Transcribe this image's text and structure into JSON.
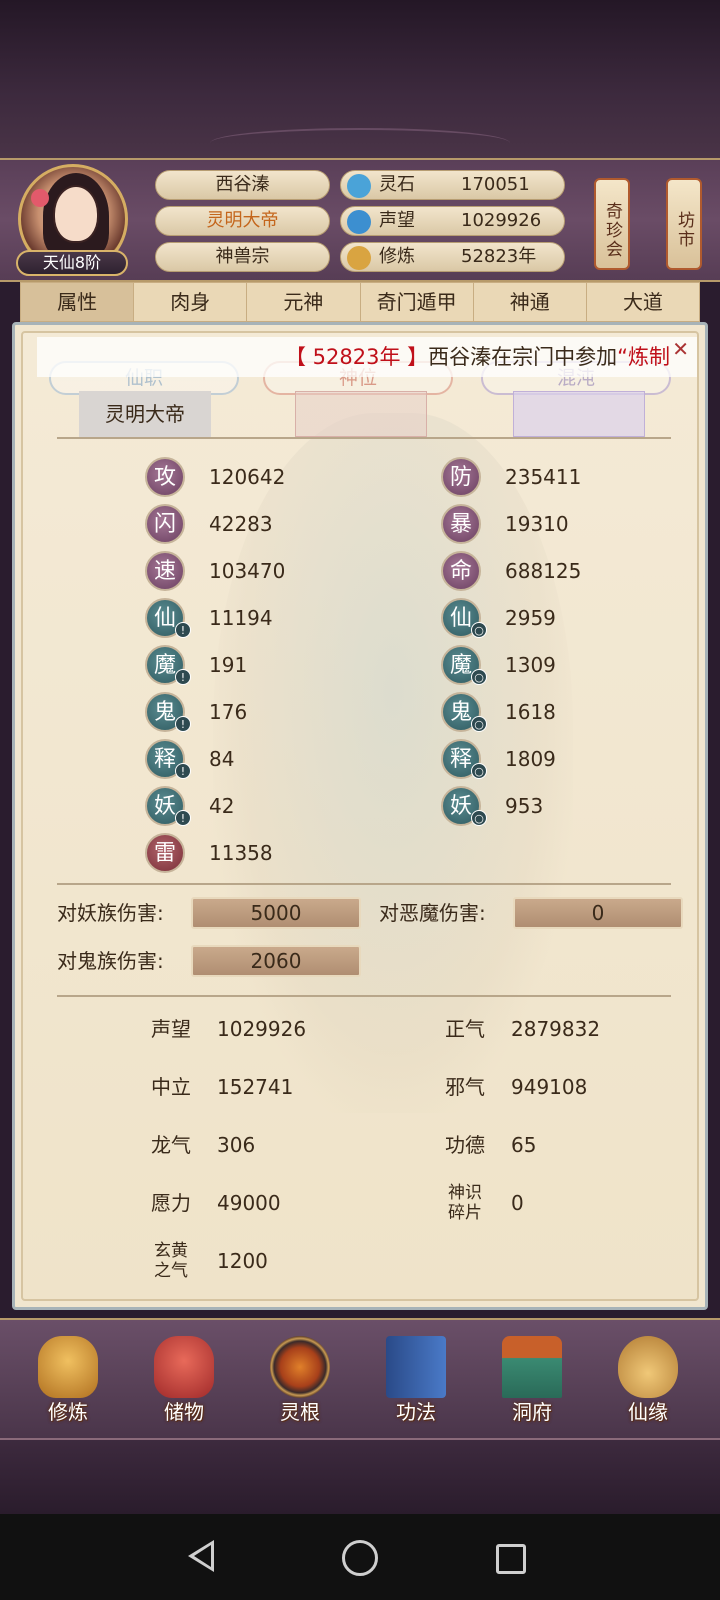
{
  "header": {
    "rank_badge": "天仙8阶",
    "player_name": "西谷溱",
    "player_title": "灵明大帝",
    "sect": "神兽宗",
    "resources": [
      {
        "icon": "spirit-stone-icon",
        "label": "灵石",
        "value": "170051",
        "color": "#4aa3d8"
      },
      {
        "icon": "reputation-icon",
        "label": "声望",
        "value": "1029926",
        "color": "#3c8fd0"
      },
      {
        "icon": "cultivation-icon",
        "label": "修炼",
        "value": "52823年",
        "color": "#d9a441"
      }
    ],
    "side_buttons": [
      "奇珍会",
      "坊市"
    ]
  },
  "tabs": [
    "属性",
    "肉身",
    "元神",
    "奇门遁甲",
    "神通",
    "大道"
  ],
  "active_tab": "属性",
  "marquee": {
    "prefix": "【 52823年 】",
    "name": "西谷溱",
    "text": "在宗门中参加",
    "suffix": "“炼制"
  },
  "rank_tabs": [
    {
      "label": "仙职",
      "value": "灵明大帝"
    },
    {
      "label": "神位",
      "value": ""
    },
    {
      "label": "混沌",
      "value": ""
    }
  ],
  "stats_left": [
    {
      "glyph": "攻",
      "value": "120642",
      "style": "purple",
      "badge": false
    },
    {
      "glyph": "闪",
      "value": "42283",
      "style": "purple",
      "badge": false
    },
    {
      "glyph": "速",
      "value": "103470",
      "style": "purple",
      "badge": false
    },
    {
      "glyph": "仙",
      "value": "11194",
      "style": "teal",
      "badge": true
    },
    {
      "glyph": "魔",
      "value": "191",
      "style": "teal",
      "badge": true
    },
    {
      "glyph": "鬼",
      "value": "176",
      "style": "teal",
      "badge": true
    },
    {
      "glyph": "释",
      "value": "84",
      "style": "teal",
      "badge": true
    },
    {
      "glyph": "妖",
      "value": "42",
      "style": "teal",
      "badge": true
    },
    {
      "glyph": "雷",
      "value": "11358",
      "style": "red",
      "badge": false
    }
  ],
  "stats_right": [
    {
      "glyph": "防",
      "value": "235411",
      "style": "purple",
      "badge": false
    },
    {
      "glyph": "暴",
      "value": "19310",
      "style": "purple",
      "badge": false
    },
    {
      "glyph": "命",
      "value": "688125",
      "style": "purple",
      "badge": false
    },
    {
      "glyph": "仙",
      "value": "2959",
      "style": "teal",
      "badge": true
    },
    {
      "glyph": "魔",
      "value": "1309",
      "style": "teal",
      "badge": true
    },
    {
      "glyph": "鬼",
      "value": "1618",
      "style": "teal",
      "badge": true
    },
    {
      "glyph": "释",
      "value": "1809",
      "style": "teal",
      "badge": true
    },
    {
      "glyph": "妖",
      "value": "953",
      "style": "teal",
      "badge": true
    }
  ],
  "damage": {
    "demon_label": "对妖族伤害:",
    "demon_value": "5000",
    "devil_label": "对恶魔伤害:",
    "devil_value": "0",
    "ghost_label": "对鬼族伤害:",
    "ghost_value": "2060"
  },
  "misc_left": [
    {
      "label": "声望",
      "value": "1029926"
    },
    {
      "label": "中立",
      "value": "152741"
    },
    {
      "label": "龙气",
      "value": "306"
    },
    {
      "label": "愿力",
      "value": "49000"
    },
    {
      "label": "玄黄之气",
      "value": "1200"
    }
  ],
  "misc_right": [
    {
      "label": "正气",
      "value": "2879832"
    },
    {
      "label": "邪气",
      "value": "949108"
    },
    {
      "label": "功德",
      "value": "65"
    },
    {
      "label": "神识碎片",
      "value": "0"
    }
  ],
  "bottom_nav": [
    {
      "label": "修炼",
      "icon": "cultivate-icon",
      "color": "#d49a3a"
    },
    {
      "label": "储物",
      "icon": "storage-bag-icon",
      "color": "#c8423a"
    },
    {
      "label": "灵根",
      "icon": "spirit-root-icon",
      "color": "#b84a2a"
    },
    {
      "label": "功法",
      "icon": "technique-book-icon",
      "color": "#3a6aa8"
    },
    {
      "label": "洞府",
      "icon": "cave-house-icon",
      "color": "#4a8a70"
    },
    {
      "label": "仙缘",
      "icon": "immortal-fate-icon",
      "color": "#d4a050"
    }
  ]
}
